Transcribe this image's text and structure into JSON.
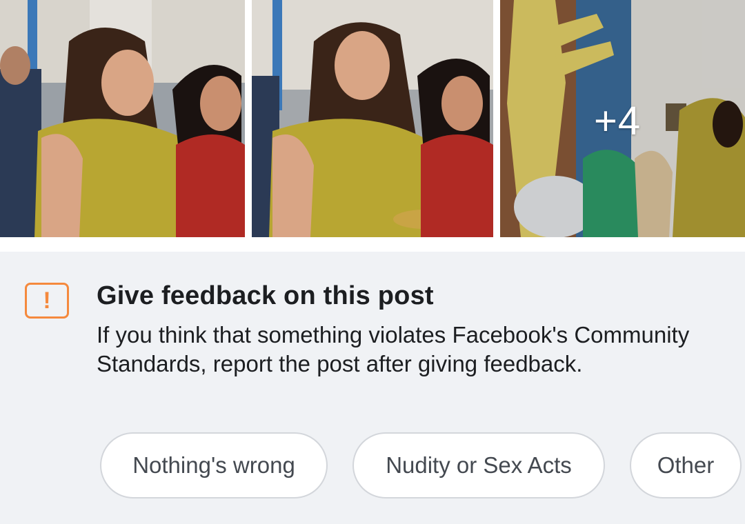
{
  "photos": {
    "more_count": "+4"
  },
  "feedback": {
    "icon": "alert-exclamation-icon",
    "icon_glyph": "!",
    "accent_color": "#f5893d",
    "title": "Give feedback on this post",
    "description": "If you think that something violates Facebook's Community Standards, report the post after giving feedback.",
    "options": [
      {
        "label": "Nothing's wrong"
      },
      {
        "label": "Nudity or Sex Acts"
      },
      {
        "label": "Other"
      }
    ]
  }
}
